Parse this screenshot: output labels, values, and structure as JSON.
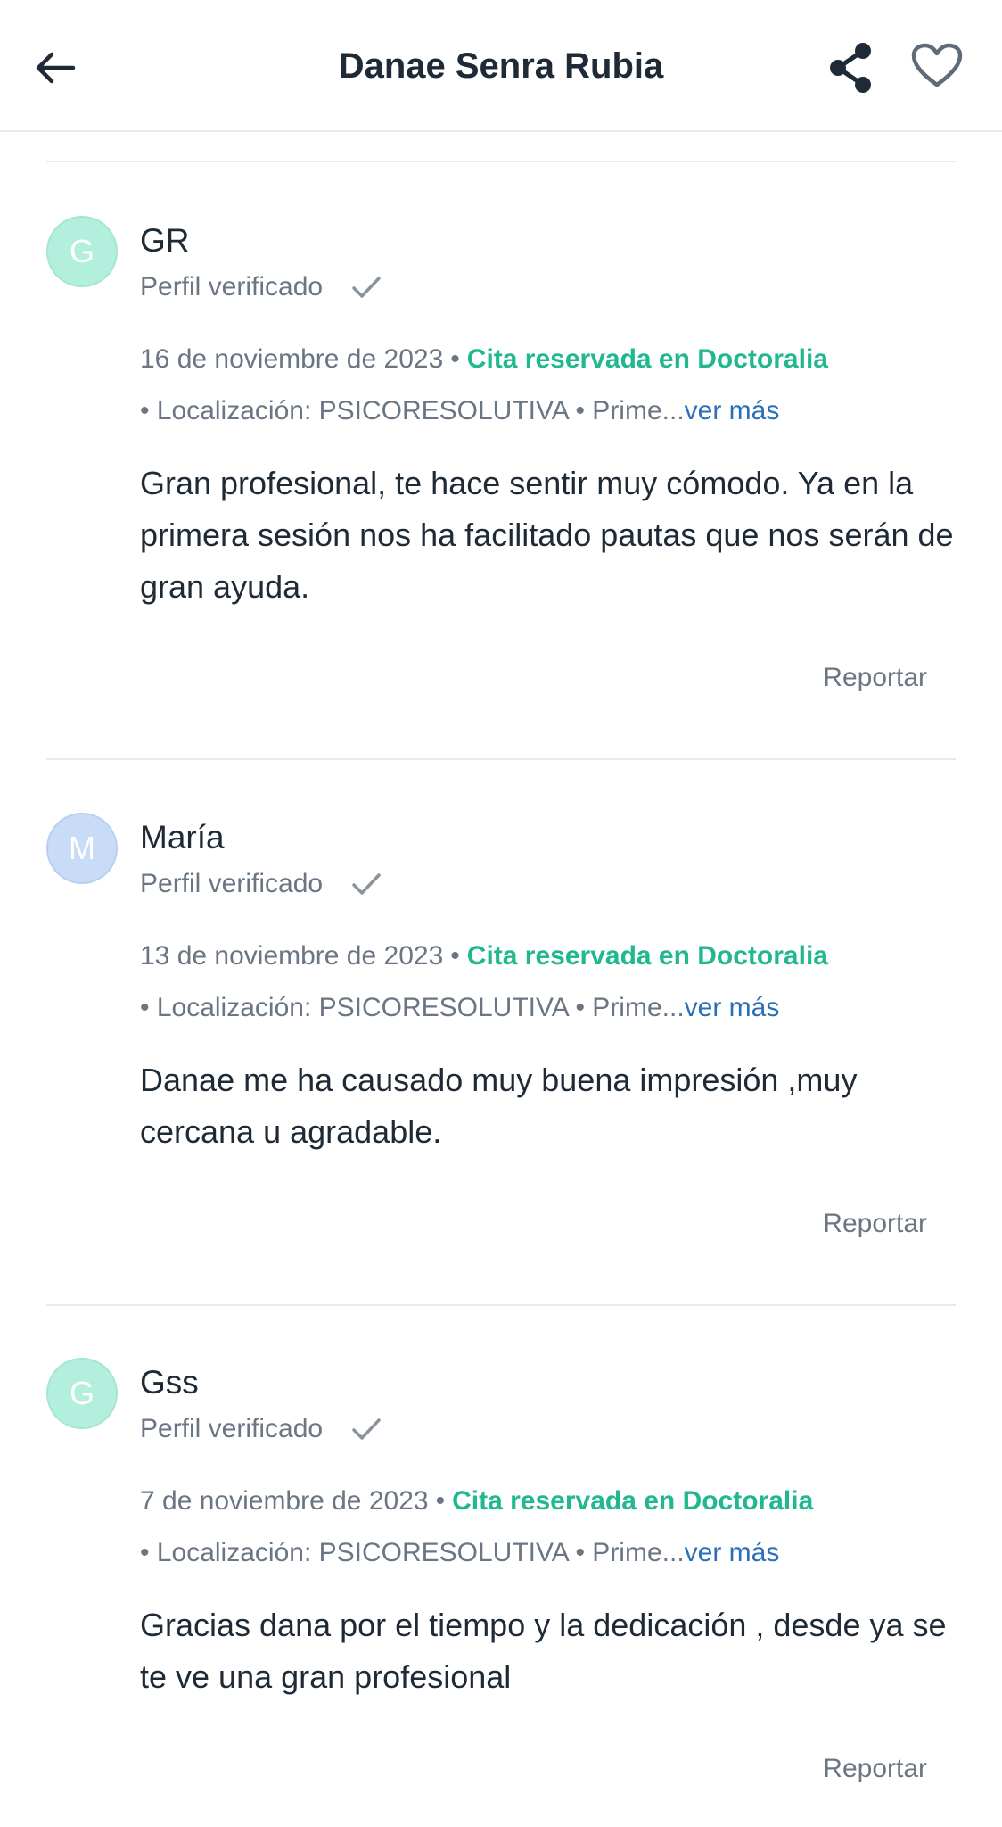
{
  "header": {
    "title": "Danae Senra Rubia",
    "back_icon": "arrow-left-icon",
    "share_icon": "share-icon",
    "favorite_icon": "heart-icon"
  },
  "colors": {
    "booked_green": "#21b890",
    "link_blue": "#2a6fb8",
    "muted_text": "#6b7684",
    "avatar_green": "#b3efdd",
    "avatar_blue": "#c9dcf7"
  },
  "reviews": [
    {
      "initial": "G",
      "name": "GR",
      "verified": "Perfil verificado",
      "date": "16 de noviembre de 2023",
      "booked": "Cita reservada en Doctoralia",
      "location": "• Localización: PSICORESOLUTIVA • Prime...",
      "more": "ver más",
      "text": "Gran profesional, te hace sentir muy cómodo. Ya en la primera sesión nos ha facilitado pautas que nos serán de gran ayuda.",
      "report": "Reportar"
    },
    {
      "initial": "M",
      "name": "María",
      "verified": "Perfil verificado",
      "date": "13 de noviembre de 2023",
      "booked": "Cita reservada en Doctoralia",
      "location": "• Localización: PSICORESOLUTIVA • Prime...",
      "more": "ver más",
      "text": "Danae me ha causado muy buena impresión ,muy cercana u agradable.",
      "report": "Reportar"
    },
    {
      "initial": "G",
      "name": "Gss",
      "verified": "Perfil verificado",
      "date": "7 de noviembre de 2023",
      "booked": "Cita reservada en Doctoralia",
      "location": "• Localización: PSICORESOLUTIVA • Prime...",
      "more": "ver más",
      "text": "Gracias dana por el tiempo y la dedicación , desde ya se te ve una gran profesional",
      "report": "Reportar"
    }
  ]
}
